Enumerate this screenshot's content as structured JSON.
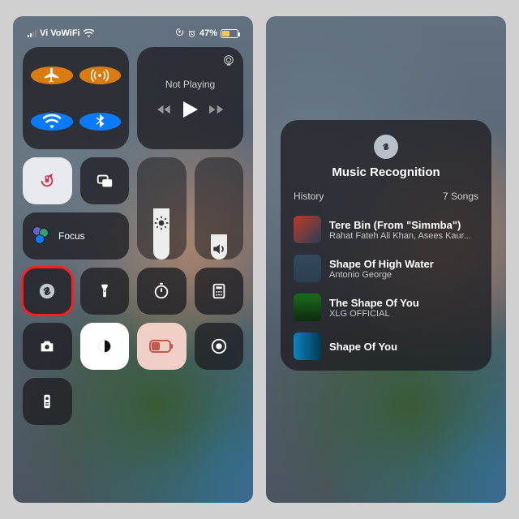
{
  "status": {
    "carrier": "Vi VoWiFi",
    "battery_pct": "47%"
  },
  "media": {
    "state": "Not Playing"
  },
  "focus": {
    "label": "Focus"
  },
  "popup": {
    "title": "Music Recognition",
    "history_label": "History",
    "history_count": "7 Songs",
    "songs": [
      {
        "title": "Tere Bin (From \"Simmba\")",
        "artist": "Rahat Fateh Ali Khan, Asees Kaur..."
      },
      {
        "title": "Shape Of High Water",
        "artist": "Antonio George"
      },
      {
        "title": "The Shape Of You",
        "artist": "XLG OFFICIAL"
      },
      {
        "title": "Shape Of You",
        "artist": ""
      }
    ]
  }
}
